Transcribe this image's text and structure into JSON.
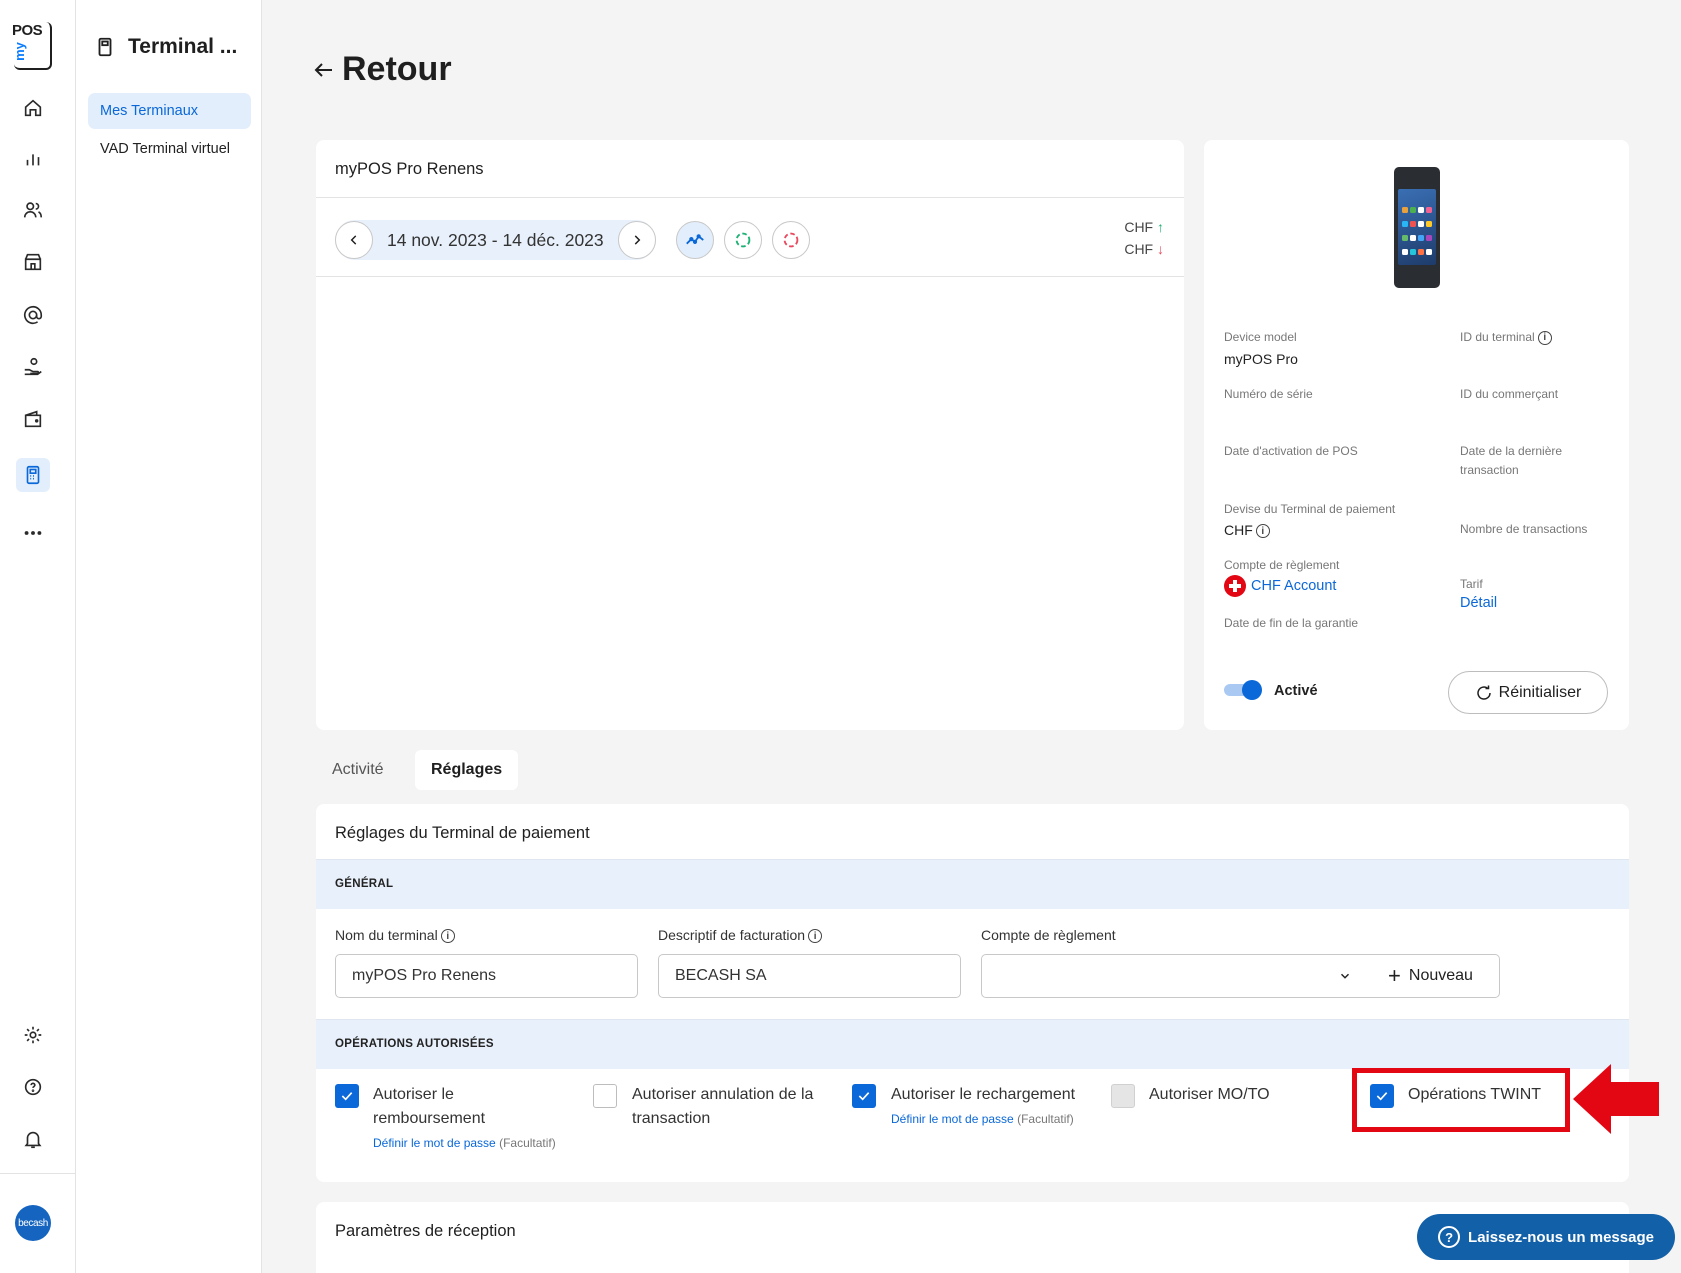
{
  "rail": {
    "logo_pos": "POS",
    "logo_my": "my",
    "avatar_text": "becash"
  },
  "subnav": {
    "title": "Terminal ...",
    "items": [
      {
        "label": "Mes Terminaux",
        "active": true
      },
      {
        "label": "VAD Terminal virtuel",
        "active": false
      }
    ]
  },
  "header": {
    "back_label": "Retour"
  },
  "chart_card": {
    "title": "myPOS Pro Renens",
    "date_range": "14 nov. 2023 - 14 déc. 2023",
    "legend": [
      {
        "currency": "CHF",
        "direction": "up",
        "color": "#1db374"
      },
      {
        "currency": "CHF",
        "direction": "down",
        "color": "#e84a5f"
      }
    ]
  },
  "device": {
    "model_label": "Device model",
    "model_value": "myPOS Pro",
    "terminal_id_label": "ID du terminal",
    "serial_label": "Numéro de série",
    "merchant_id_label": "ID du commerçant",
    "activation_label": "Date d'activation de POS",
    "last_tx_label_1": "Date de la dernière",
    "last_tx_label_2": "transaction",
    "currency_label": "Devise du Terminal de paiement",
    "currency_value": "CHF",
    "tx_count_label": "Nombre de transactions",
    "settlement_label": "Compte de règlement",
    "settlement_value": "CHF Account",
    "tariff_label": "Tarif",
    "tariff_link": "Détail",
    "warranty_label": "Date de fin de la garantie",
    "status_label": "Activé",
    "reset_label": "Réinitialiser"
  },
  "tabs": [
    {
      "label": "Activité",
      "active": false
    },
    {
      "label": "Réglages",
      "active": true
    }
  ],
  "settings": {
    "title": "Réglages du Terminal de paiement",
    "general_heading": "GÉNÉRAL",
    "name_label": "Nom du terminal",
    "name_value": "myPOS Pro Renens",
    "billing_label": "Descriptif de facturation",
    "billing_value": "BECASH SA",
    "account_label": "Compte de règlement",
    "account_value": "",
    "new_label": "Nouveau",
    "ops_heading": "OPÉRATIONS AUTORISÉES",
    "ops": {
      "refund_1": "Autoriser le",
      "refund_2": "remboursement",
      "cancel_1": "Autoriser annulation de la",
      "cancel_2": "transaction",
      "recharge": "Autoriser le rechargement",
      "moto": "Autoriser MO/TO",
      "twint": "Opérations TWINT",
      "password_link": "Définir le mot de passe",
      "optional": "(Facultatif)"
    }
  },
  "reception": {
    "title": "Paramètres de réception"
  },
  "chat": {
    "label": "Laissez-nous un message"
  }
}
